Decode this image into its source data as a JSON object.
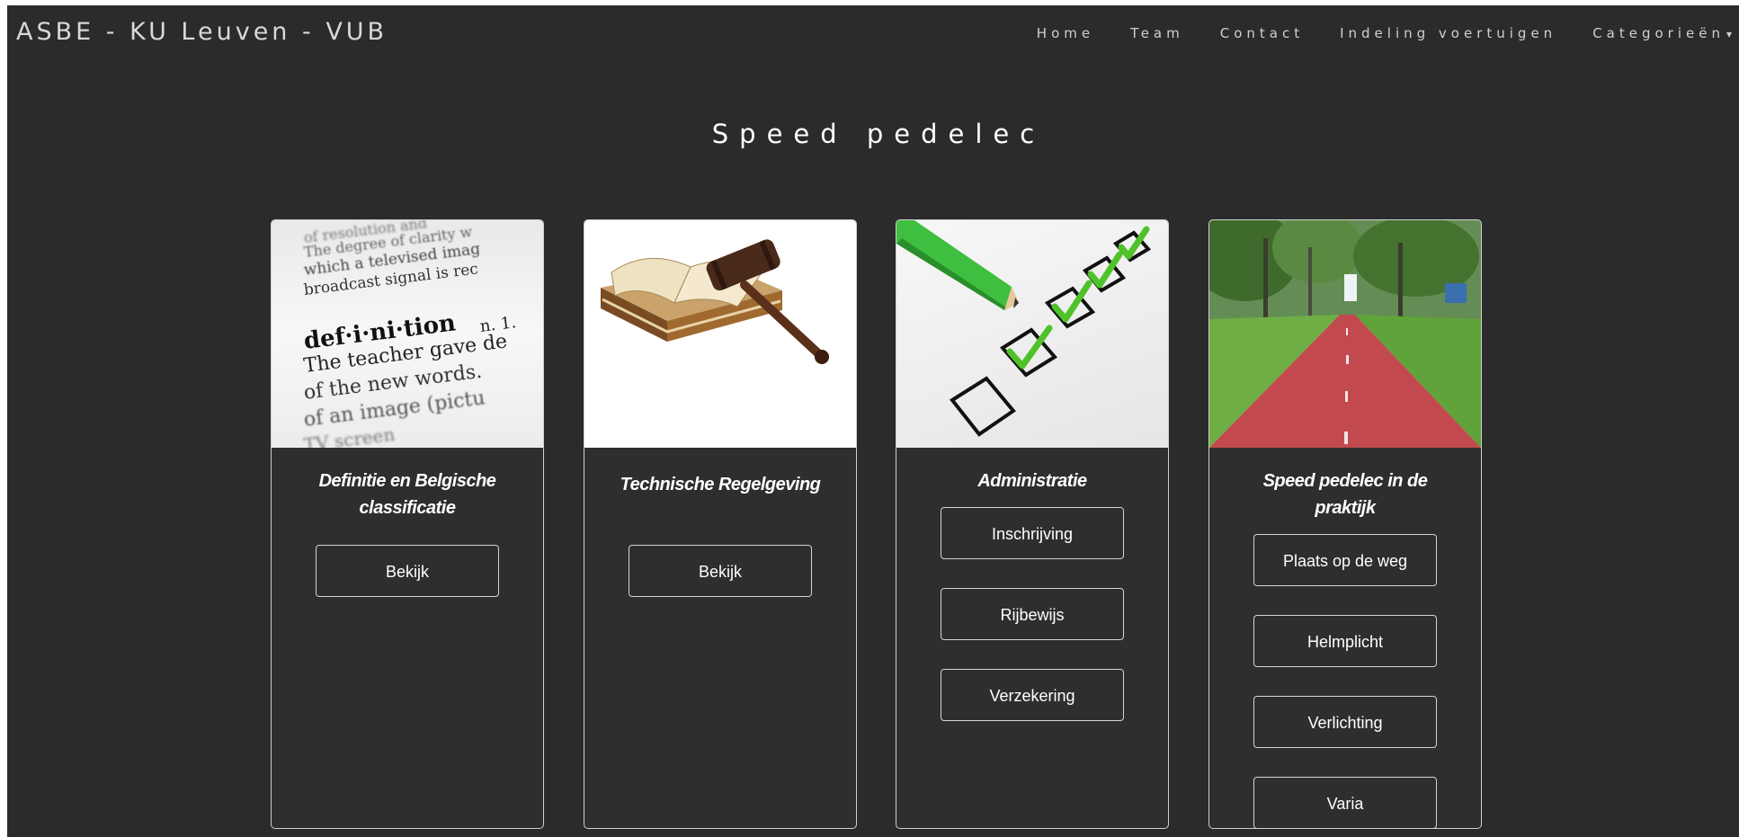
{
  "header": {
    "brand": "ASBE - KU Leuven - VUB",
    "nav": [
      "Home",
      "Team",
      "Contact",
      "Indeling voertuigen",
      "Categorieën"
    ],
    "dropdown_caret": "▾"
  },
  "page_title": "Speed pedelec",
  "cards": [
    {
      "title": "Definitie en Belgische classificatie",
      "image": "dictionary-definition",
      "image_text": [
        "of resolution and",
        "The degree of clarity w",
        "which a televised imag",
        "broadcast signal is rec",
        "def·i·ni·tion",
        "n. 1.",
        "The teacher gave de",
        "of the new words.",
        "of an image (pictu",
        "TV screen"
      ],
      "buttons": [
        "Bekijk"
      ]
    },
    {
      "title": "Technische Regelgeving",
      "image": "gavel-and-book",
      "buttons": [
        "Bekijk"
      ]
    },
    {
      "title": "Administratie",
      "image": "checklist-pencil",
      "buttons": [
        "Inschrijving",
        "Rijbewijs",
        "Verzekering"
      ]
    },
    {
      "title": "Speed pedelec in de praktijk",
      "image": "red-bike-lane",
      "buttons": [
        "Plaats op de weg",
        "Helmplicht",
        "Verlichting",
        "Varia"
      ]
    }
  ],
  "colors": {
    "background": "#2b2b2b",
    "card_border": "#cfcfcf",
    "text": "#ffffff",
    "nav_text": "#d0d0d0"
  }
}
